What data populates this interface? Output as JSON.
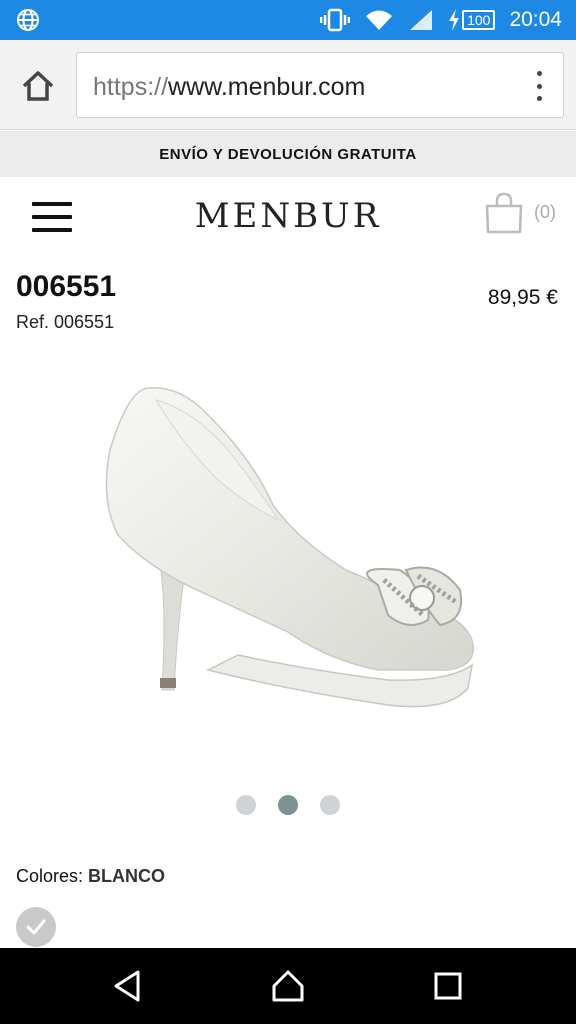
{
  "status_bar": {
    "battery": "100",
    "time": "20:04",
    "icons": [
      "globe-icon",
      "vibrate-icon",
      "wifi-icon",
      "signal-icon",
      "charging-icon",
      "battery-icon"
    ]
  },
  "browser": {
    "url_scheme": "https://",
    "url_host": "www.menbur.com",
    "icons": [
      "home-icon",
      "overflow-menu-icon"
    ]
  },
  "promo": {
    "text": "ENVÍO Y DEVOLUCIÓN GRATUITA"
  },
  "header": {
    "logo": "MENBUR",
    "cart_count": "(0)",
    "icons": [
      "hamburger-menu-icon",
      "shopping-bag-icon"
    ]
  },
  "product": {
    "title": "006551",
    "ref": "Ref. 006551",
    "price": "89,95 €",
    "image": "white-satin-peep-toe-heel-with-crystal-bow",
    "carousel": {
      "total": 3,
      "active_index": 1
    },
    "colors_label": "Colores:",
    "color_value": "BLANCO"
  },
  "nav_bar": {
    "icons": [
      "back-icon",
      "home-icon",
      "recents-icon"
    ]
  },
  "colors": {
    "status_bar": "#1e88e5",
    "promo_bg": "#ececec",
    "dot_active": "#7f9292",
    "dot_inactive": "#cdd3d6"
  }
}
